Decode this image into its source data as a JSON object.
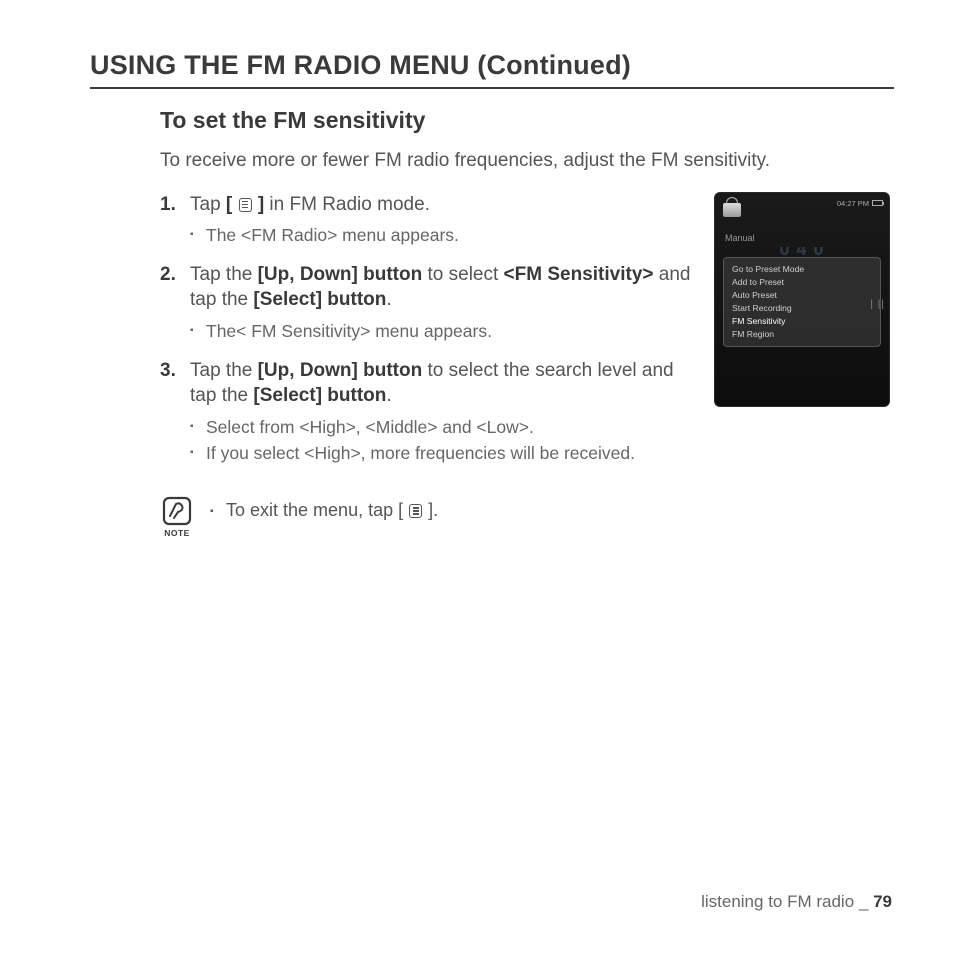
{
  "page_title": "USING THE FM RADIO MENU (Continued)",
  "subtitle": "To set the FM sensitivity",
  "intro": "To receive more or fewer FM radio frequencies, adjust the FM sensitivity.",
  "steps": [
    {
      "pre": "Tap ",
      "bold1": "[",
      "icon": true,
      "bold2": "]",
      "post": " in FM Radio mode.",
      "subs": [
        "The <FM Radio> menu appears."
      ]
    },
    {
      "pre": "Tap the ",
      "bold1": "[Up, Down] button",
      "mid": " to select ",
      "bold2": "<FM Sensitivity>",
      "mid2": " and tap the ",
      "bold3": "[Select] button",
      "post": ".",
      "subs": [
        "The< FM Sensitivity> menu appears."
      ]
    },
    {
      "pre": "Tap the ",
      "bold1": "[Up, Down] button",
      "mid": " to select the search level and tap the ",
      "bold2": "[Select] button",
      "post": ".",
      "subs": [
        "Select from <High>, <Middle> and <Low>.",
        "If you select <High>, more frequencies will be received."
      ]
    }
  ],
  "note": {
    "label": "NOTE",
    "text_pre": "To exit the menu, tap [",
    "text_post": "]."
  },
  "device": {
    "time": "04:27 PM",
    "mode": "Manual",
    "menu_items": [
      "Go to Preset Mode",
      "Add to Preset",
      "Auto Preset",
      "Start Recording",
      "FM Sensitivity",
      "FM Region"
    ],
    "selected_index": 4
  },
  "footer": {
    "section": "listening to FM radio",
    "sep": " _ ",
    "page": "79"
  }
}
